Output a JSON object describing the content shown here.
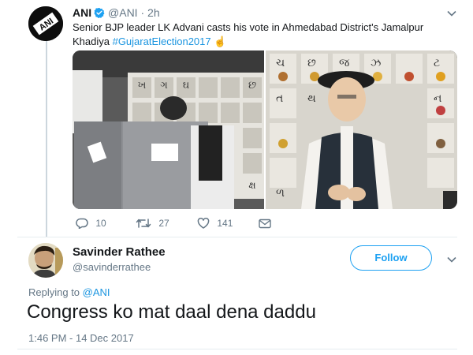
{
  "tweet": {
    "avatar_label": "ANI",
    "name": "ANI",
    "handle": "@ANI",
    "separator": "·",
    "time": "2h",
    "text_part1": "Senior BJP leader LK Advani casts his vote in Ahmedabad District's Jamalpur Khadiya ",
    "hashtag": "#GujaratElection2017",
    "emoji": "☝",
    "media_alt": "LK Advani standing near voting compartment with Gujarati alphabet chart in background",
    "chart_letters": [
      "ખ",
      "ગ",
      "ઘ",
      "છ",
      "ચ",
      "છ",
      "જ",
      "ઝ",
      "ટ",
      "ત",
      "થ",
      "ન",
      "ળ",
      "ક્ષ"
    ],
    "actions": {
      "replies": "10",
      "retweets": "27",
      "likes": "141"
    }
  },
  "reply": {
    "name": "Savinder Rathee",
    "handle": "@savinderrathee",
    "follow_label": "Follow",
    "replying_prefix": "Replying to",
    "replying_handle": "@ANI",
    "text": "Congress ko mat daal dena daddu",
    "timestamp": "1:46 PM - 14 Dec 2017"
  },
  "colors": {
    "link": "#1b95e0",
    "follow": "#1da1f2",
    "muted": "#657786",
    "verified": "#1da1f2"
  }
}
